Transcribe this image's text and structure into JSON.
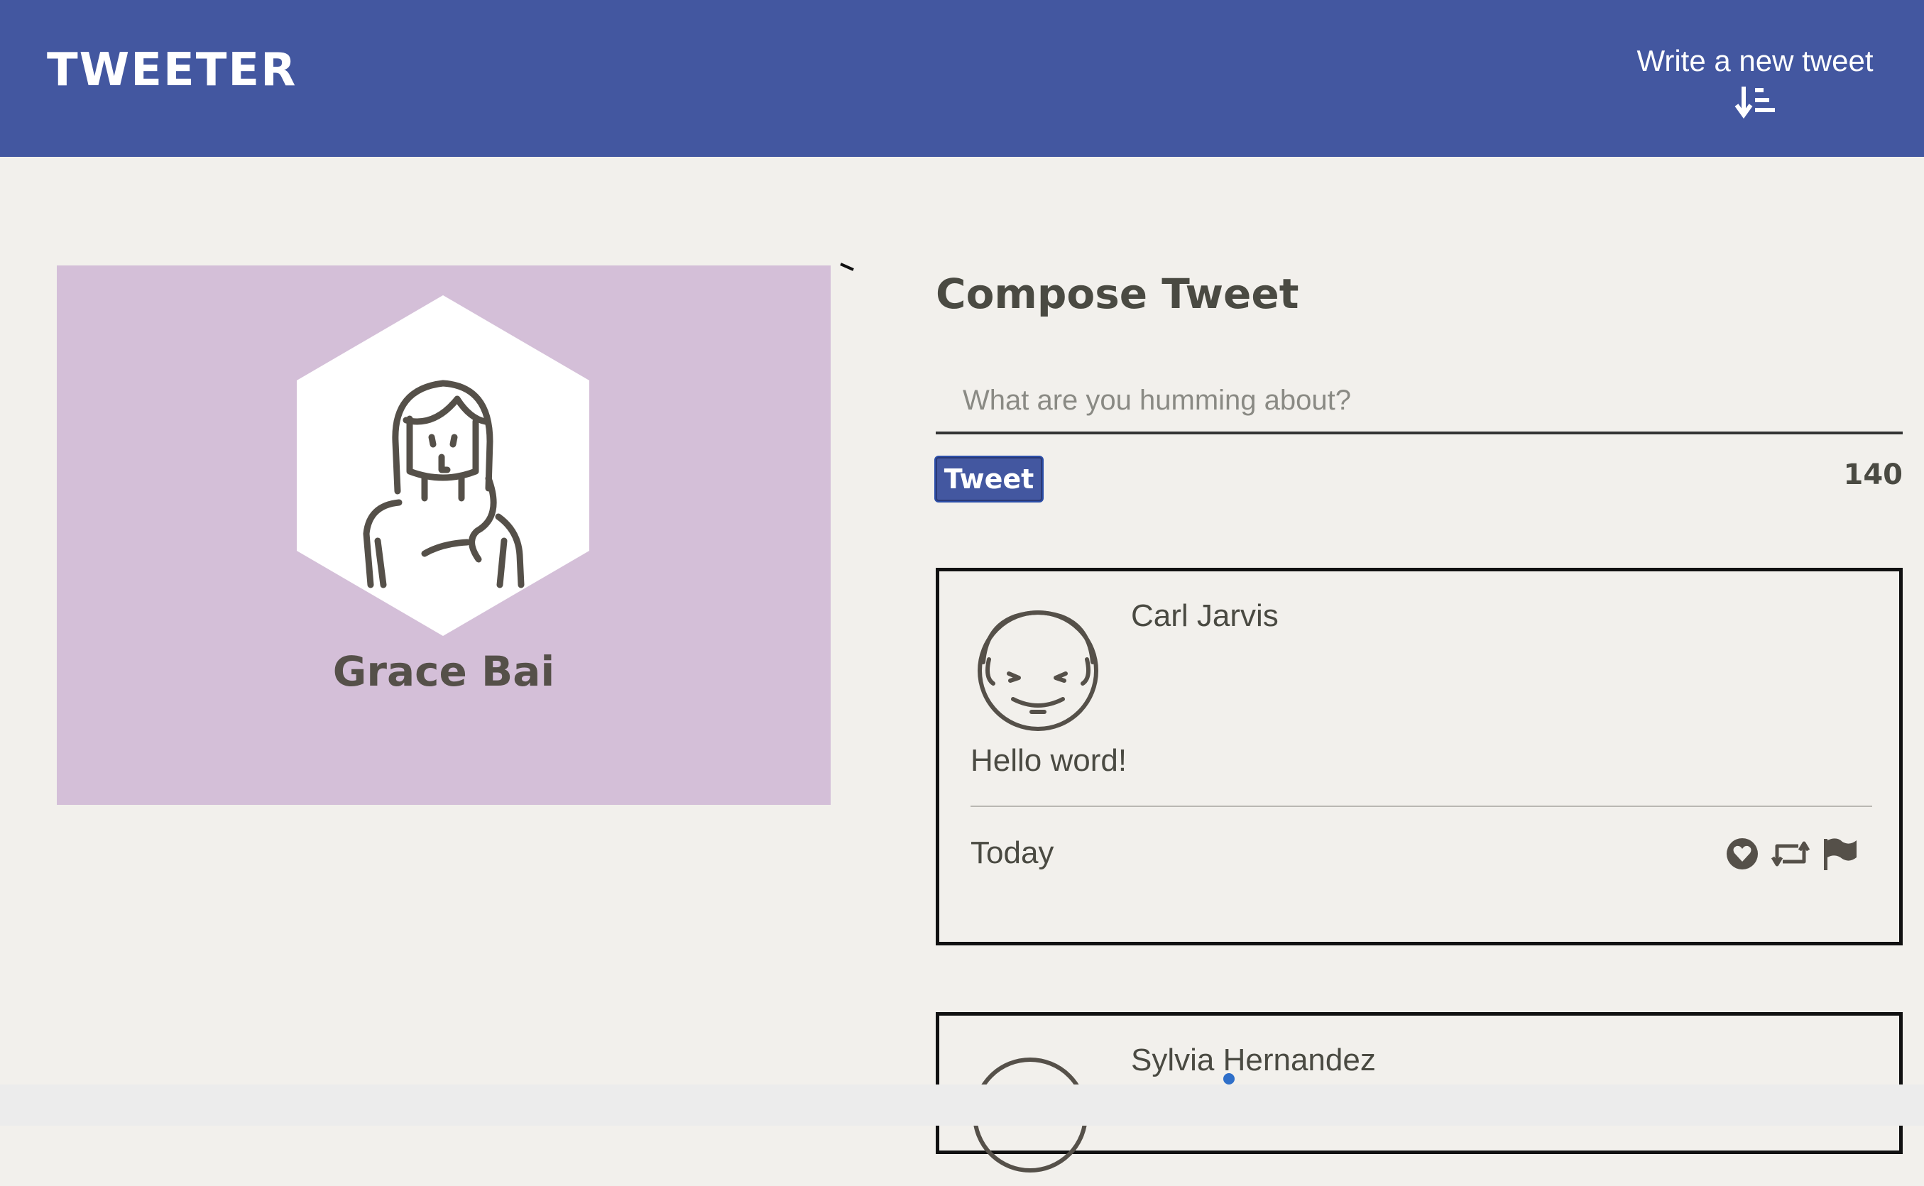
{
  "header": {
    "logo": "TWEETER",
    "write_link_label": "Write a new tweet",
    "write_link_icon": "sort-down-icon",
    "background_color": "#4357a0"
  },
  "profile": {
    "name": "Grace Bai",
    "avatar_icon": "woman-avatar-icon",
    "card_color": "#d4bfd8"
  },
  "compose": {
    "title": "Compose Tweet",
    "placeholder": "What are you humming about?",
    "value": "",
    "button_label": "Tweet",
    "char_count": "140"
  },
  "tweets": [
    {
      "author": "Carl Jarvis",
      "text": "Hello word!",
      "time": "Today",
      "avatar_icon": "man-avatar-icon",
      "actions": [
        "heart-icon",
        "retweet-icon",
        "flag-icon"
      ]
    },
    {
      "author": "Sylvia Hernandez",
      "avatar_icon": "avatar-icon"
    }
  ]
}
